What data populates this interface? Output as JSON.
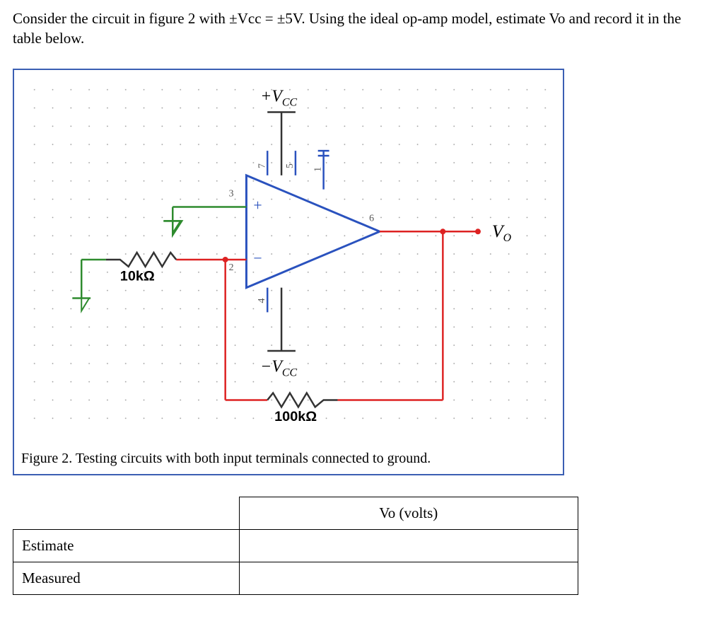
{
  "problem": "Consider the circuit in figure 2 with ±Vcc = ±5V. Using the ideal op-amp model, estimate Vo and record it in the table below.",
  "figure": {
    "vcc_pos": "+V",
    "vcc_pos_sub": "CC",
    "vcc_neg": "−V",
    "vcc_neg_sub": "CC",
    "vo": "V",
    "vo_sub": "O",
    "r1": "10kΩ",
    "r2": "100kΩ",
    "pin1": "1",
    "pin2": "2",
    "pin3": "3",
    "pin4": "4",
    "pin5": "5",
    "pin6": "6",
    "pin7": "7",
    "plus": "+",
    "minus": "−",
    "caption": "Figure 2. Testing circuits with both input terminals connected to ground."
  },
  "table": {
    "header_vo": "Vo (volts)",
    "row1": "Estimate",
    "row2": "Measured",
    "cell1": "",
    "cell2": ""
  }
}
